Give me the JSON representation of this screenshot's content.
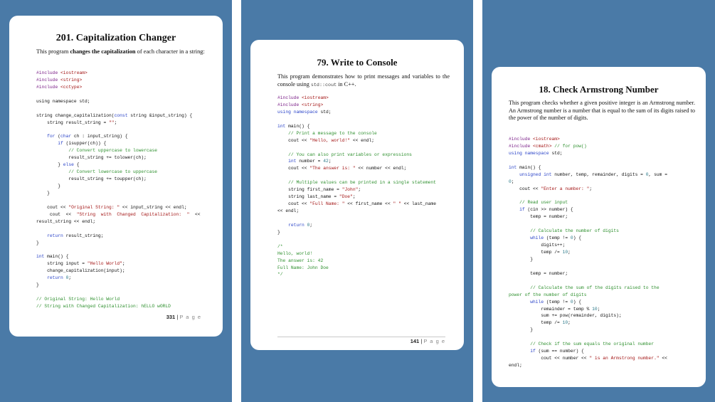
{
  "pages": [
    {
      "title": "201. Capitalization Changer",
      "intro": {
        "before": "This program ",
        "bold": "changes the capitalization",
        "after": " of each character in a string:"
      },
      "code": [
        [
          [
            "inc",
            "#include "
          ],
          [
            "hdr",
            "<iostream>"
          ]
        ],
        [
          [
            "inc",
            "#include "
          ],
          [
            "hdr",
            "<string>"
          ]
        ],
        [
          [
            "inc",
            "#include "
          ],
          [
            "hdr",
            "<cctype>"
          ]
        ],
        [],
        [
          [
            "",
            "using namespace std;"
          ]
        ],
        [],
        [
          [
            "",
            "string change_capitalization("
          ],
          [
            "kw",
            "const"
          ],
          [
            "",
            " string &input_string) {"
          ]
        ],
        [
          [
            "",
            "    string result_string = "
          ],
          [
            "str",
            "\"\""
          ],
          [
            "",
            ";"
          ]
        ],
        [],
        [
          [
            "kw",
            "    for"
          ],
          [
            "",
            " ("
          ],
          [
            "kw",
            "char"
          ],
          [
            "",
            " ch : input_string) {"
          ]
        ],
        [
          [
            "kw",
            "        if"
          ],
          [
            "",
            " (isupper(ch)) {"
          ]
        ],
        [
          [
            "cm",
            "            // Convert uppercase to lowercase"
          ]
        ],
        [
          [
            "",
            "            result_string += tolower(ch);"
          ]
        ],
        [
          [
            "",
            "        } "
          ],
          [
            "kw",
            "else"
          ],
          [
            "",
            " {"
          ]
        ],
        [
          [
            "cm",
            "            // Convert lowercase to uppercase"
          ]
        ],
        [
          [
            "",
            "            result_string += toupper(ch);"
          ]
        ],
        [
          [
            "",
            "        }"
          ]
        ],
        [
          [
            "",
            "    }"
          ]
        ],
        [],
        [
          [
            "",
            "    cout << "
          ],
          [
            "str",
            "\"Original String: \""
          ],
          [
            "",
            " << input_string << endl;"
          ]
        ],
        [
          [
            "",
            "     cout  <<  "
          ],
          [
            "str",
            "\"String  with  Changed  Capitalization:  \""
          ],
          [
            "",
            "  <<"
          ]
        ],
        [
          [
            "",
            "result_string << endl;"
          ]
        ],
        [],
        [
          [
            "kw",
            "    return"
          ],
          [
            "",
            " result_string;"
          ]
        ],
        [
          [
            "",
            "}"
          ]
        ],
        [],
        [
          [
            "kw",
            "int"
          ],
          [
            "",
            " main() {"
          ]
        ],
        [
          [
            "",
            "    string input = "
          ],
          [
            "str",
            "\"Hello World\""
          ],
          [
            "",
            ";"
          ]
        ],
        [
          [
            "",
            "    change_capitalization(input);"
          ]
        ],
        [
          [
            "kw",
            "    return"
          ],
          [
            "",
            " "
          ],
          [
            "num",
            "0"
          ],
          [
            "",
            ";"
          ]
        ],
        [
          [
            "",
            "}"
          ]
        ],
        [],
        [
          [
            "cm",
            "// Original String: Hello World"
          ]
        ],
        [
          [
            "cm",
            "// String with Changed Capitalization: hELLO wORLD"
          ]
        ]
      ],
      "page_number": "331",
      "page_word": "P a g e"
    },
    {
      "title": "79. Write to Console",
      "intro": {
        "before": "This program demonstrates how to print messages and variables to the console using ",
        "code": "std::cout",
        "after": " in C++."
      },
      "code": [
        [
          [
            "inc",
            "#include "
          ],
          [
            "hdr",
            "<iostream>"
          ]
        ],
        [
          [
            "inc",
            "#include "
          ],
          [
            "hdr",
            "<string>"
          ]
        ],
        [
          [
            "kw",
            "using namespace"
          ],
          [
            "",
            " std;"
          ]
        ],
        [],
        [
          [
            "kw",
            "int"
          ],
          [
            "",
            " main() {"
          ]
        ],
        [
          [
            "cm",
            "    // Print a message to the console"
          ]
        ],
        [
          [
            "",
            "    cout << "
          ],
          [
            "str",
            "\"Hello, world!\""
          ],
          [
            "",
            " << endl;"
          ]
        ],
        [],
        [
          [
            "cm",
            "    // You can also print variables or expressions"
          ]
        ],
        [
          [
            "kw",
            "    int"
          ],
          [
            "",
            " number = "
          ],
          [
            "num",
            "42"
          ],
          [
            "",
            ";"
          ]
        ],
        [
          [
            "",
            "    cout << "
          ],
          [
            "str",
            "\"The answer is: \""
          ],
          [
            "",
            " << number << endl;"
          ]
        ],
        [],
        [
          [
            "cm",
            "    // Multiple values can be printed in a single statement"
          ]
        ],
        [
          [
            "",
            "    string first_name = "
          ],
          [
            "str",
            "\"John\""
          ],
          [
            "",
            ";"
          ]
        ],
        [
          [
            "",
            "    string last_name = "
          ],
          [
            "str",
            "\"Doe\""
          ],
          [
            "",
            ";"
          ]
        ],
        [
          [
            "",
            "    cout << "
          ],
          [
            "str",
            "\"Full Name: \""
          ],
          [
            "",
            " << first_name << "
          ],
          [
            "str",
            "\" \""
          ],
          [
            "",
            " << last_name"
          ]
        ],
        [
          [
            "",
            "<< endl;"
          ]
        ],
        [],
        [
          [
            "kw",
            "    return"
          ],
          [
            "",
            " "
          ],
          [
            "num",
            "0"
          ],
          [
            "",
            ";"
          ]
        ],
        [
          [
            "",
            "}"
          ]
        ],
        [],
        [
          [
            "cm",
            "/*"
          ]
        ],
        [
          [
            "cm",
            "Hello, world!"
          ]
        ],
        [
          [
            "cm",
            "The answer is: 42"
          ]
        ],
        [
          [
            "cm",
            "Full Name: John Doe"
          ]
        ],
        [
          [
            "cm",
            "*/"
          ]
        ]
      ],
      "page_number": "141",
      "page_word": "P a g e"
    },
    {
      "title": "18. Check Armstrong Number",
      "intro": {
        "before": "This program checks whether a given positive integer is an Armstrong number. An Armstrong number is a number that is equal to the sum of its digits raised to the power of the number of digits.",
        "bold": "",
        "after": ""
      },
      "code": [
        [
          [
            "inc",
            "#include "
          ],
          [
            "hdr",
            "<iostream>"
          ]
        ],
        [
          [
            "inc",
            "#include "
          ],
          [
            "hdr",
            "<cmath>"
          ],
          [
            "cm",
            " // for pow()"
          ]
        ],
        [
          [
            "kw",
            "using namespace"
          ],
          [
            "",
            " std;"
          ]
        ],
        [],
        [
          [
            "kw",
            "int"
          ],
          [
            "",
            " main() {"
          ]
        ],
        [
          [
            "kw",
            "    unsigned int"
          ],
          [
            "",
            " number, temp, remainder, digits = "
          ],
          [
            "num",
            "0"
          ],
          [
            "",
            ", sum ="
          ]
        ],
        [
          [
            "num",
            "0"
          ],
          [
            "",
            ";"
          ]
        ],
        [
          [
            "",
            "    cout << "
          ],
          [
            "str",
            "\"Enter a number: \""
          ],
          [
            "",
            ";"
          ]
        ],
        [],
        [
          [
            "cm",
            "    // Read user input"
          ]
        ],
        [
          [
            "kw",
            "    if"
          ],
          [
            "",
            " (cin >> number) {"
          ]
        ],
        [
          [
            "",
            "        temp = number;"
          ]
        ],
        [],
        [
          [
            "cm",
            "        // Calculate the number of digits"
          ]
        ],
        [
          [
            "kw",
            "        while"
          ],
          [
            "",
            " (temp != "
          ],
          [
            "num",
            "0"
          ],
          [
            "",
            ") {"
          ]
        ],
        [
          [
            "",
            "            digits++;"
          ]
        ],
        [
          [
            "",
            "            temp /= "
          ],
          [
            "num",
            "10"
          ],
          [
            "",
            ";"
          ]
        ],
        [
          [
            "",
            "        }"
          ]
        ],
        [],
        [
          [
            "",
            "        temp = number;"
          ]
        ],
        [],
        [
          [
            "cm",
            "        // Calculate the sum of the digits raised to the"
          ]
        ],
        [
          [
            "cm",
            "power of the number of digits"
          ]
        ],
        [
          [
            "kw",
            "        while"
          ],
          [
            "",
            " (temp != "
          ],
          [
            "num",
            "0"
          ],
          [
            "",
            ") {"
          ]
        ],
        [
          [
            "",
            "            remainder = temp % "
          ],
          [
            "num",
            "10"
          ],
          [
            "",
            ";"
          ]
        ],
        [
          [
            "",
            "            sum += pow(remainder, digits);"
          ]
        ],
        [
          [
            "",
            "            temp /= "
          ],
          [
            "num",
            "10"
          ],
          [
            "",
            ";"
          ]
        ],
        [
          [
            "",
            "        }"
          ]
        ],
        [],
        [
          [
            "cm",
            "        // Check if the sum equals the original number"
          ]
        ],
        [
          [
            "kw",
            "        if"
          ],
          [
            "",
            " (sum == number) {"
          ]
        ],
        [
          [
            "",
            "            cout << number << "
          ],
          [
            "str",
            "\" is an Armstrong number.\""
          ],
          [
            "",
            " <<"
          ]
        ],
        [
          [
            "",
            "endl;"
          ]
        ]
      ],
      "page_number": "",
      "page_word": ""
    }
  ]
}
